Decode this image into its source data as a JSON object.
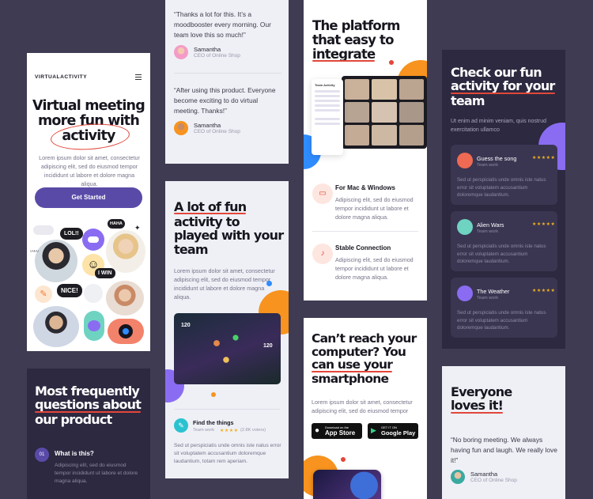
{
  "colors": {
    "background": "#3f3b52",
    "accent": "#e2473a",
    "primary": "#5a4aa8",
    "orange": "#f7931e",
    "blue": "#2f8cff"
  },
  "c1": {
    "logo": "VIRTUALACTIVITY",
    "menu_icon": "hamburger-icon",
    "hero": [
      "Virtual meeting",
      "more fun with",
      "activity"
    ],
    "body": "Lorem ipsum dolor sit amet, consectetur adipiscing elit, sed do eiusmod tempor incididunt ut labore et dolore magna aliqua.",
    "cta": "Get Started",
    "bubbles": {
      "lol": "LOL!!",
      "haha": "HAHA",
      "win": "I WIN",
      "nice": "NICE!"
    }
  },
  "c2": {
    "t1": "“Thanks a lot for this. It’s a moodbooster every morning. Our team love this so much!”",
    "t2": "“After using this product. Everyone become exciting to do virtual meeting. Thanks!”",
    "name": "Samantha",
    "role": "CEO of Online Shop"
  },
  "c3": {
    "title": [
      "The platform",
      "that easy to",
      "integrate"
    ],
    "app": {
      "title": "Team Activity"
    },
    "f1": {
      "title": "For Mac & Windows",
      "text": "Adipiscing elit, sed do eiusmod tempor incididunt ut labore et dolore magna aliqua."
    },
    "f2": {
      "title": "Stable Connection",
      "text": "Adipiscing elit, sed do eiusmod tempor incididunt ut labore et dolore magna aliqua."
    }
  },
  "c4": {
    "title": [
      "Check our fun",
      "activity for your",
      "team"
    ],
    "sub": "Ut enim ad minim veniam, quis nostrud exercitation ullamco",
    "items": [
      {
        "name": "Guess the song",
        "tag": "Team work",
        "stars": "★★★★★",
        "text": "Sed ut perspiciatis unde omnis iste natus error sit voluptatem accusantium doloremque laudantium.",
        "color": "#ef6a52"
      },
      {
        "name": "Alien Wars",
        "tag": "Team work",
        "stars": "★★★★★",
        "text": "Sed ut perspiciatis unde omnis iste natus error sit voluptatem accusantium doloremque laudantium.",
        "color": "#6fd3c2"
      },
      {
        "name": "The Weather",
        "tag": "Team work",
        "stars": "★★★★★",
        "text": "Sed ut perspiciatis unde omnis iste natus error sit voluptatem accusantium doloremque laudantium.",
        "color": "#8a6cf2"
      }
    ]
  },
  "c5": {
    "title": [
      "Most frequently",
      "questions about",
      "our product"
    ],
    "q_num": "01",
    "q": "What is this?",
    "a": "Adipiscing elit, sed do eiusmod tempor incididunt ut labore et dolore magna aliqua."
  },
  "c6": {
    "title": [
      "A lot of fun",
      "activity to",
      "played with your",
      "team"
    ],
    "body": "Lorem ipsum dolor sit amet, consectetur adipiscing elit, sed do eiusmod tempor incididunt ut labore et dolore magna aliqua.",
    "score1": "120",
    "score2": "120",
    "game": {
      "name": "Find the things",
      "tag": "Team work",
      "stars": "★★★★",
      "votes": "(2.8K voters)",
      "text": "Sed ut perspiciatis unde omnis iste natus error sit voluptatem accusantium doloremque laudantium, totam rem aperiam."
    }
  },
  "c7": {
    "title": [
      "Can’t reach your",
      "computer? You",
      "can use your",
      "smartphone"
    ],
    "body": "Lorem ipsum dolor sit amet, consectetur adipiscing elit, sed do eiusmod tempor",
    "appstore": {
      "small": "Download on the",
      "big": "App Store"
    },
    "gplay": {
      "small": "GET IT ON",
      "big": "Google Play"
    }
  },
  "c8": {
    "title": [
      "Everyone",
      "loves it!"
    ],
    "quote": "“No boring meeting. We always having fun and laugh. We really love it!”",
    "name": "Samantha",
    "role": "CEO of Online Shop"
  }
}
